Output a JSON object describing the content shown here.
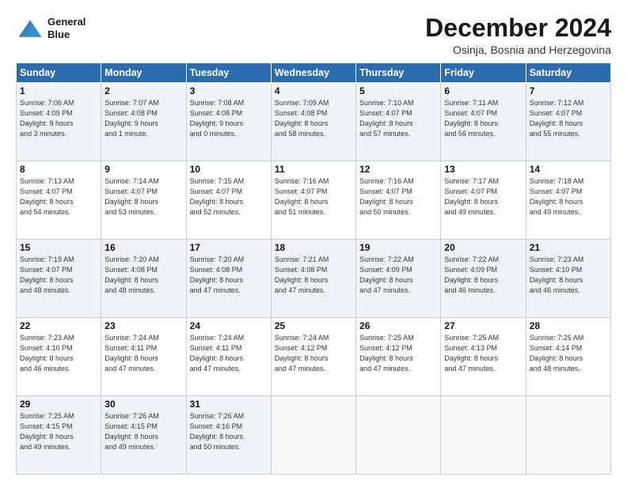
{
  "logo": {
    "line1": "General",
    "line2": "Blue"
  },
  "title": "December 2024",
  "subtitle": "Osinja, Bosnia and Herzegovina",
  "header_days": [
    "Sunday",
    "Monday",
    "Tuesday",
    "Wednesday",
    "Thursday",
    "Friday",
    "Saturday"
  ],
  "weeks": [
    [
      {
        "day": "1",
        "info": "Sunrise: 7:06 AM\nSunset: 4:09 PM\nDaylight: 9 hours\nand 3 minutes."
      },
      {
        "day": "2",
        "info": "Sunrise: 7:07 AM\nSunset: 4:08 PM\nDaylight: 9 hours\nand 1 minute."
      },
      {
        "day": "3",
        "info": "Sunrise: 7:08 AM\nSunset: 4:08 PM\nDaylight: 9 hours\nand 0 minutes."
      },
      {
        "day": "4",
        "info": "Sunrise: 7:09 AM\nSunset: 4:08 PM\nDaylight: 8 hours\nand 58 minutes."
      },
      {
        "day": "5",
        "info": "Sunrise: 7:10 AM\nSunset: 4:07 PM\nDaylight: 8 hours\nand 57 minutes."
      },
      {
        "day": "6",
        "info": "Sunrise: 7:11 AM\nSunset: 4:07 PM\nDaylight: 8 hours\nand 56 minutes."
      },
      {
        "day": "7",
        "info": "Sunrise: 7:12 AM\nSunset: 4:07 PM\nDaylight: 8 hours\nand 55 minutes."
      }
    ],
    [
      {
        "day": "8",
        "info": "Sunrise: 7:13 AM\nSunset: 4:07 PM\nDaylight: 8 hours\nand 54 minutes."
      },
      {
        "day": "9",
        "info": "Sunrise: 7:14 AM\nSunset: 4:07 PM\nDaylight: 8 hours\nand 53 minutes."
      },
      {
        "day": "10",
        "info": "Sunrise: 7:15 AM\nSunset: 4:07 PM\nDaylight: 8 hours\nand 52 minutes."
      },
      {
        "day": "11",
        "info": "Sunrise: 7:16 AM\nSunset: 4:07 PM\nDaylight: 8 hours\nand 51 minutes."
      },
      {
        "day": "12",
        "info": "Sunrise: 7:16 AM\nSunset: 4:07 PM\nDaylight: 8 hours\nand 50 minutes."
      },
      {
        "day": "13",
        "info": "Sunrise: 7:17 AM\nSunset: 4:07 PM\nDaylight: 8 hours\nand 49 minutes."
      },
      {
        "day": "14",
        "info": "Sunrise: 7:18 AM\nSunset: 4:07 PM\nDaylight: 8 hours\nand 49 minutes."
      }
    ],
    [
      {
        "day": "15",
        "info": "Sunrise: 7:19 AM\nSunset: 4:07 PM\nDaylight: 8 hours\nand 48 minutes."
      },
      {
        "day": "16",
        "info": "Sunrise: 7:20 AM\nSunset: 4:08 PM\nDaylight: 8 hours\nand 48 minutes."
      },
      {
        "day": "17",
        "info": "Sunrise: 7:20 AM\nSunset: 4:08 PM\nDaylight: 8 hours\nand 47 minutes."
      },
      {
        "day": "18",
        "info": "Sunrise: 7:21 AM\nSunset: 4:08 PM\nDaylight: 8 hours\nand 47 minutes."
      },
      {
        "day": "19",
        "info": "Sunrise: 7:22 AM\nSunset: 4:09 PM\nDaylight: 8 hours\nand 47 minutes."
      },
      {
        "day": "20",
        "info": "Sunrise: 7:22 AM\nSunset: 4:09 PM\nDaylight: 8 hours\nand 46 minutes."
      },
      {
        "day": "21",
        "info": "Sunrise: 7:23 AM\nSunset: 4:10 PM\nDaylight: 8 hours\nand 46 minutes."
      }
    ],
    [
      {
        "day": "22",
        "info": "Sunrise: 7:23 AM\nSunset: 4:10 PM\nDaylight: 8 hours\nand 46 minutes."
      },
      {
        "day": "23",
        "info": "Sunrise: 7:24 AM\nSunset: 4:11 PM\nDaylight: 8 hours\nand 47 minutes."
      },
      {
        "day": "24",
        "info": "Sunrise: 7:24 AM\nSunset: 4:11 PM\nDaylight: 8 hours\nand 47 minutes."
      },
      {
        "day": "25",
        "info": "Sunrise: 7:24 AM\nSunset: 4:12 PM\nDaylight: 8 hours\nand 47 minutes."
      },
      {
        "day": "26",
        "info": "Sunrise: 7:25 AM\nSunset: 4:12 PM\nDaylight: 8 hours\nand 47 minutes."
      },
      {
        "day": "27",
        "info": "Sunrise: 7:25 AM\nSunset: 4:13 PM\nDaylight: 8 hours\nand 47 minutes."
      },
      {
        "day": "28",
        "info": "Sunrise: 7:25 AM\nSunset: 4:14 PM\nDaylight: 8 hours\nand 48 minutes."
      }
    ],
    [
      {
        "day": "29",
        "info": "Sunrise: 7:25 AM\nSunset: 4:15 PM\nDaylight: 8 hours\nand 49 minutes."
      },
      {
        "day": "30",
        "info": "Sunrise: 7:26 AM\nSunset: 4:15 PM\nDaylight: 8 hours\nand 49 minutes."
      },
      {
        "day": "31",
        "info": "Sunrise: 7:26 AM\nSunset: 4:16 PM\nDaylight: 8 hours\nand 50 minutes."
      },
      {
        "day": "",
        "info": ""
      },
      {
        "day": "",
        "info": ""
      },
      {
        "day": "",
        "info": ""
      },
      {
        "day": "",
        "info": ""
      }
    ]
  ]
}
